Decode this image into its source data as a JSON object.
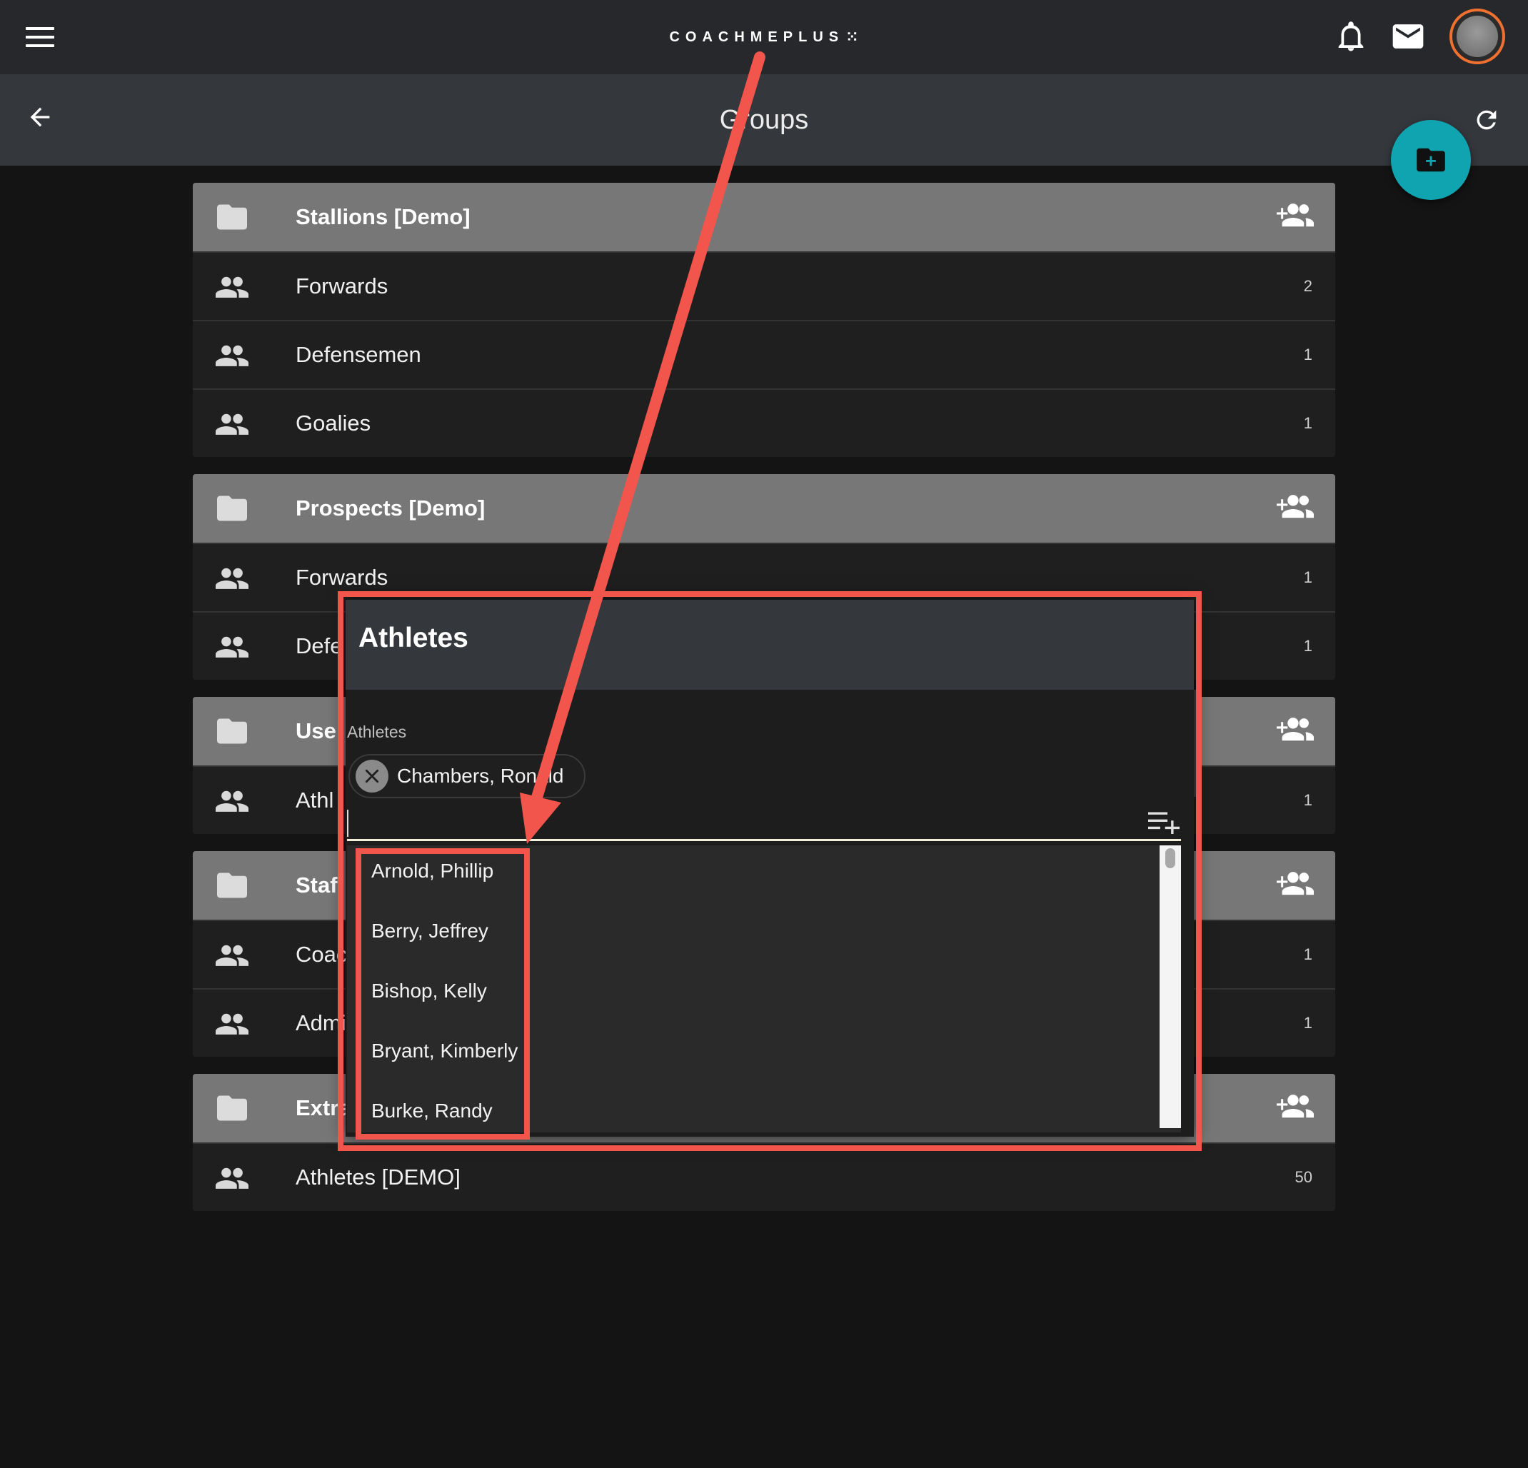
{
  "topbar": {
    "brand": "COACHMEPLUS",
    "brand_mark": "⁙",
    "menu_icon": "hamburger-menu-icon",
    "notifications_icon": "bell-icon",
    "messages_icon": "mail-icon",
    "avatar_icon": "user-avatar"
  },
  "page": {
    "title": "Groups",
    "back_icon": "arrow-back-icon",
    "refresh_icon": "refresh-icon",
    "fab_icon": "create-folder-icon",
    "fab_color": "#10a4b0"
  },
  "groups": [
    {
      "title": "Stallions [Demo]",
      "subgroups": [
        {
          "label": "Forwards",
          "count": "2"
        },
        {
          "label": "Defensemen",
          "count": "1"
        },
        {
          "label": "Goalies",
          "count": "1"
        }
      ]
    },
    {
      "title": "Prospects [Demo]",
      "subgroups": [
        {
          "label": "Forwards",
          "count": "1"
        },
        {
          "label": "Defe",
          "count": "1"
        }
      ]
    },
    {
      "title": "Use",
      "subgroups": [
        {
          "label": "Athl",
          "count": "1"
        }
      ]
    },
    {
      "title": "Staf",
      "subgroups": [
        {
          "label": "Coac",
          "count": "1"
        },
        {
          "label": "Admi",
          "count": "1"
        }
      ]
    },
    {
      "title": "Extra",
      "subgroups": [
        {
          "label": "Athletes [DEMO]",
          "count": "50"
        }
      ]
    }
  ],
  "dialog": {
    "title": "Athletes",
    "field_label": "Athletes",
    "selected_chips": [
      "Chambers, Ronald"
    ],
    "input_value": "",
    "options": [
      "Arnold, Phillip",
      "Berry, Jeffrey",
      "Bishop, Kelly",
      "Bryant, Kimberly",
      "Burke, Randy"
    ]
  },
  "annotation_color": "#f2554c"
}
